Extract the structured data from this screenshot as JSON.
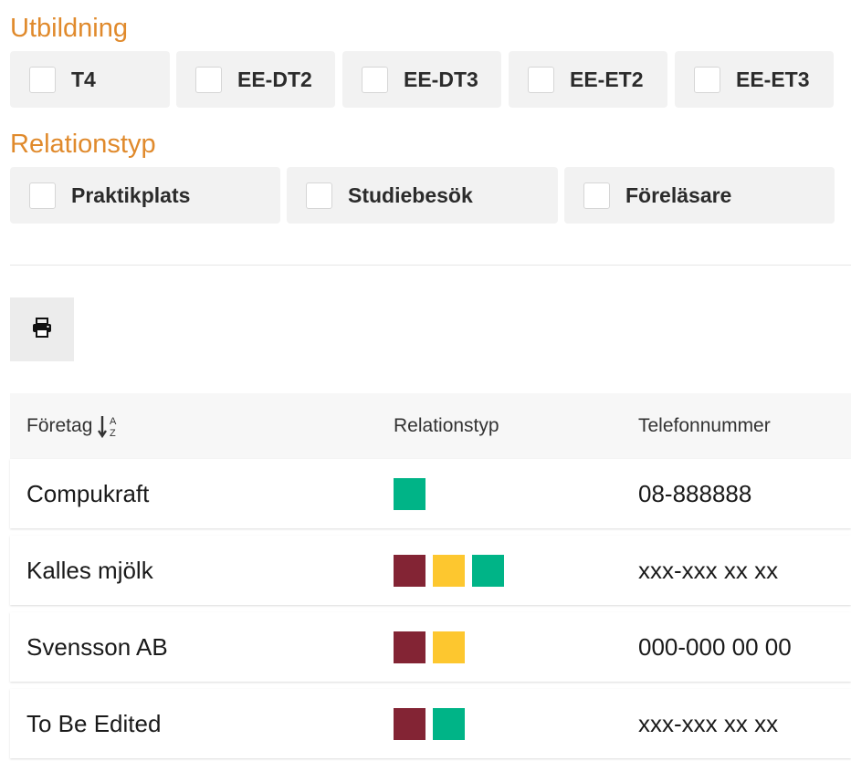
{
  "utbildning": {
    "title": "Utbildning",
    "options": [
      {
        "label": "T4",
        "checked": false
      },
      {
        "label": "EE-DT2",
        "checked": false
      },
      {
        "label": "EE-DT3",
        "checked": false
      },
      {
        "label": "EE-ET2",
        "checked": false
      },
      {
        "label": "EE-ET3",
        "checked": false
      }
    ]
  },
  "relationstyp": {
    "title": "Relationstyp",
    "options": [
      {
        "label": "Praktikplats",
        "checked": false
      },
      {
        "label": "Studiebesök",
        "checked": false
      },
      {
        "label": "Föreläsare",
        "checked": false
      }
    ]
  },
  "toolbar": {
    "print_icon": "printer-icon"
  },
  "table": {
    "headers": {
      "company": "Företag",
      "sort_icon": "sort-alpha-down-icon",
      "relation": "Relationstyp",
      "phone": "Telefonnummer"
    },
    "colors": {
      "maroon": "#832434",
      "yellow": "#fdc72f",
      "green": "#00b487"
    },
    "rows": [
      {
        "company": "Compukraft",
        "relations": [
          "green"
        ],
        "phone": "08-888888"
      },
      {
        "company": "Kalles mjölk",
        "relations": [
          "maroon",
          "yellow",
          "green"
        ],
        "phone": "xxx-xxx xx xx"
      },
      {
        "company": "Svensson AB",
        "relations": [
          "maroon",
          "yellow"
        ],
        "phone": "000-000 00 00"
      },
      {
        "company": "To Be Edited",
        "relations": [
          "maroon",
          "green"
        ],
        "phone": "xxx-xxx xx xx"
      }
    ]
  }
}
